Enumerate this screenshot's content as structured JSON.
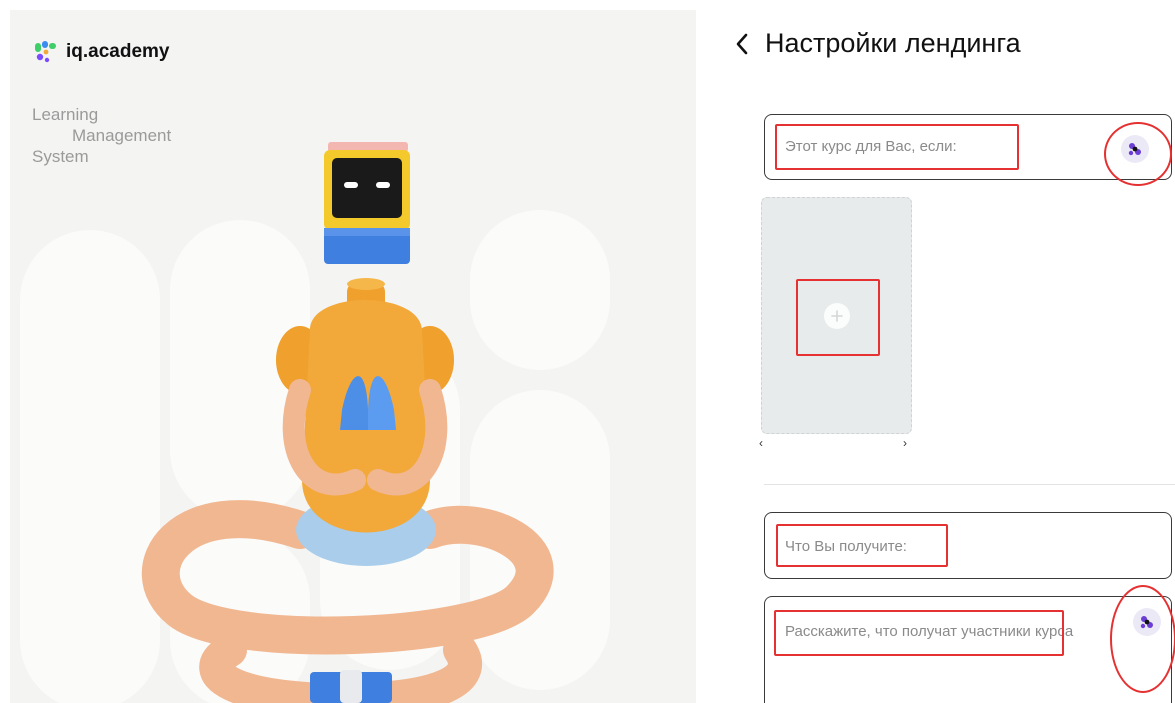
{
  "brand": {
    "name": "iq.academy"
  },
  "tagline": [
    "Learning",
    "Management",
    "System"
  ],
  "header": {
    "title": "Настройки лендинга"
  },
  "form": {
    "course_for_placeholder": "Этот курс для Вас, если:",
    "you_get_placeholder": "Что Вы получите:",
    "tell_placeholder": "Расскажите, что получат участники курса"
  },
  "colors": {
    "accent": "#6b3fd6",
    "annotation": "#e53131",
    "robot_body": "#f2a93a",
    "robot_blue": "#3f7fe0"
  }
}
